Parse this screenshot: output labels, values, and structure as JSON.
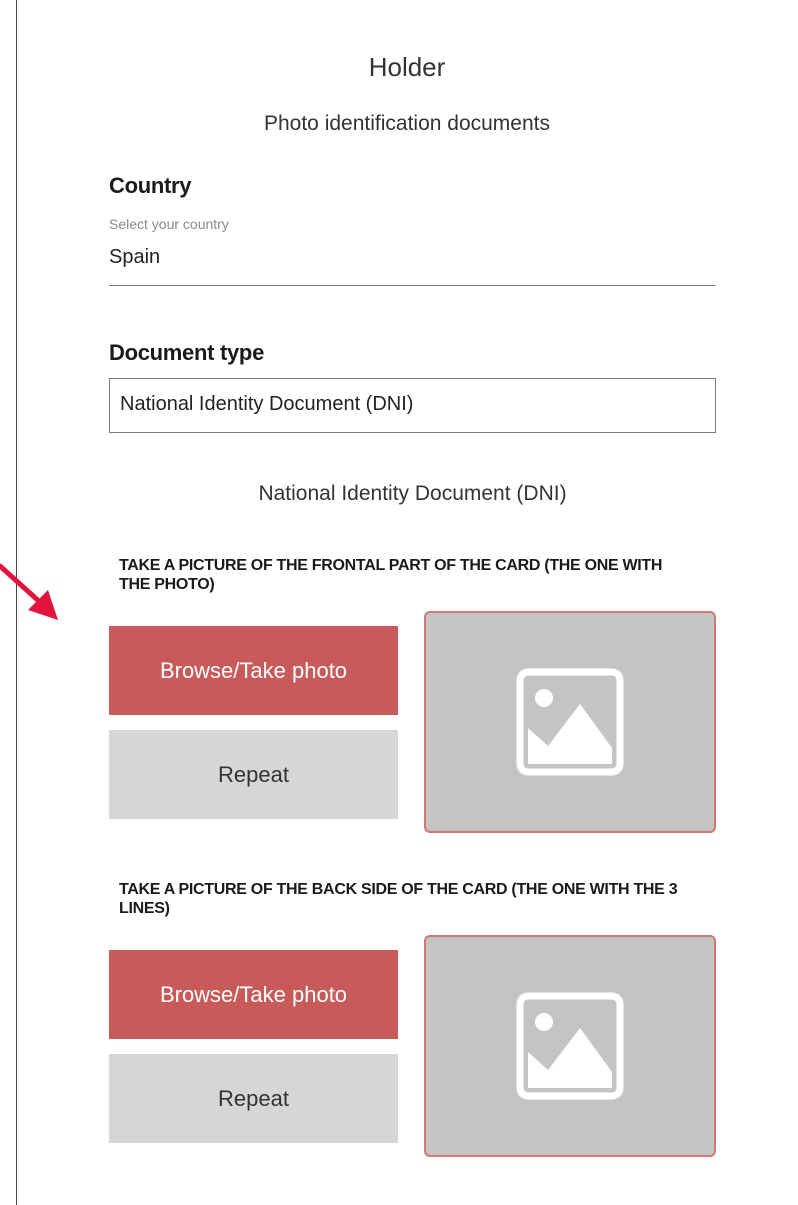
{
  "form": {
    "title": "Holder",
    "subtitle": "Photo identification documents",
    "country": {
      "label": "Country",
      "hint": "Select your country",
      "value": "Spain"
    },
    "document_type": {
      "label": "Document type",
      "value": "National Identity Document (DNI)"
    },
    "selected_document_name": "National Identity Document (DNI)"
  },
  "front_side": {
    "instruction": "TAKE A PICTURE OF THE FRONTAL PART OF THE CARD (THE ONE WITH THE PHOTO)",
    "browse_label": "Browse/Take photo",
    "repeat_label": "Repeat",
    "preview_icon": "image-placeholder-icon"
  },
  "back_side": {
    "instruction": "TAKE A PICTURE OF THE BACK SIDE OF THE CARD (THE ONE WITH THE 3 LINES)",
    "browse_label": "Browse/Take photo",
    "repeat_label": "Repeat",
    "preview_icon": "image-placeholder-icon"
  },
  "annotation": {
    "icon": "red-arrow-icon"
  },
  "colors": {
    "primary_button": "#c85a5a",
    "secondary_button": "#d6d6d6",
    "preview_background": "#c4c4c4",
    "preview_border": "#d47777",
    "annotation_arrow": "#e0143c"
  }
}
